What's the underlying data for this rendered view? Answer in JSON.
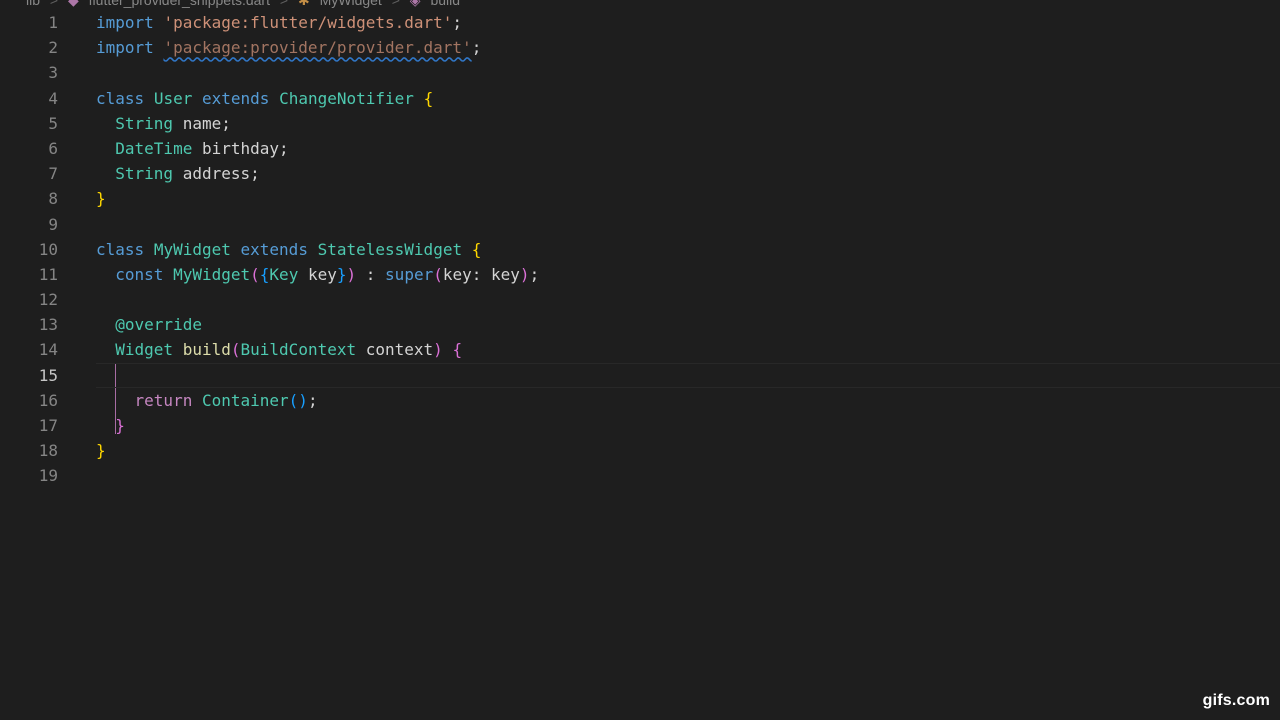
{
  "breadcrumb": {
    "folder": "lib",
    "file": "flutter_provider_snippets.dart",
    "class": "MyWidget",
    "method": "build",
    "separator": ">"
  },
  "lines": [
    {
      "n": "1",
      "tokens": [
        [
          "kw",
          "import"
        ],
        [
          "plain",
          " "
        ],
        [
          "str",
          "'package:flutter/widgets.dart'"
        ],
        [
          "plain",
          ";"
        ]
      ]
    },
    {
      "n": "2",
      "tokens": [
        [
          "kw",
          "import"
        ],
        [
          "plain",
          " "
        ],
        [
          "str squiggle",
          "'package:provider/provider.dart'"
        ],
        [
          "plain",
          ";"
        ]
      ]
    },
    {
      "n": "3",
      "tokens": []
    },
    {
      "n": "4",
      "tokens": [
        [
          "kw",
          "class"
        ],
        [
          "plain",
          " "
        ],
        [
          "type",
          "User"
        ],
        [
          "plain",
          " "
        ],
        [
          "kw",
          "extends"
        ],
        [
          "plain",
          " "
        ],
        [
          "type",
          "ChangeNotifier"
        ],
        [
          "plain",
          " "
        ],
        [
          "br1",
          "{"
        ]
      ]
    },
    {
      "n": "5",
      "tokens": [
        [
          "plain",
          "  "
        ],
        [
          "type",
          "String"
        ],
        [
          "plain",
          " name;"
        ]
      ]
    },
    {
      "n": "6",
      "tokens": [
        [
          "plain",
          "  "
        ],
        [
          "type",
          "DateTime"
        ],
        [
          "plain",
          " birthday;"
        ]
      ]
    },
    {
      "n": "7",
      "tokens": [
        [
          "plain",
          "  "
        ],
        [
          "type",
          "String"
        ],
        [
          "plain",
          " address;"
        ]
      ]
    },
    {
      "n": "8",
      "tokens": [
        [
          "br1",
          "}"
        ]
      ]
    },
    {
      "n": "9",
      "tokens": []
    },
    {
      "n": "10",
      "tokens": [
        [
          "kw",
          "class"
        ],
        [
          "plain",
          " "
        ],
        [
          "type",
          "MyWidget"
        ],
        [
          "plain",
          " "
        ],
        [
          "kw",
          "extends"
        ],
        [
          "plain",
          " "
        ],
        [
          "type",
          "StatelessWidget"
        ],
        [
          "plain",
          " "
        ],
        [
          "br1",
          "{"
        ]
      ]
    },
    {
      "n": "11",
      "tokens": [
        [
          "plain",
          "  "
        ],
        [
          "kw",
          "const"
        ],
        [
          "plain",
          " "
        ],
        [
          "type",
          "MyWidget"
        ],
        [
          "br2",
          "("
        ],
        [
          "br3",
          "{"
        ],
        [
          "type",
          "Key"
        ],
        [
          "plain",
          " key"
        ],
        [
          "br3",
          "}"
        ],
        [
          "br2",
          ")"
        ],
        [
          "plain",
          " : "
        ],
        [
          "kw",
          "super"
        ],
        [
          "br2",
          "("
        ],
        [
          "plain",
          "key: key"
        ],
        [
          "br2",
          ")"
        ],
        [
          "plain",
          ";"
        ]
      ]
    },
    {
      "n": "12",
      "tokens": []
    },
    {
      "n": "13",
      "tokens": [
        [
          "plain",
          "  "
        ],
        [
          "anno",
          "@override"
        ]
      ]
    },
    {
      "n": "14",
      "tokens": [
        [
          "plain",
          "  "
        ],
        [
          "type",
          "Widget"
        ],
        [
          "plain",
          " "
        ],
        [
          "fn",
          "build"
        ],
        [
          "br2",
          "("
        ],
        [
          "type",
          "BuildContext"
        ],
        [
          "plain",
          " context"
        ],
        [
          "br2",
          ")"
        ],
        [
          "plain",
          " "
        ],
        [
          "br2",
          "{"
        ]
      ]
    },
    {
      "n": "15",
      "tokens": []
    },
    {
      "n": "16",
      "tokens": [
        [
          "plain",
          "    "
        ],
        [
          "ctrl",
          "return"
        ],
        [
          "plain",
          " "
        ],
        [
          "type",
          "Container"
        ],
        [
          "br3",
          "()"
        ],
        [
          "plain",
          ";"
        ]
      ]
    },
    {
      "n": "17",
      "tokens": [
        [
          "plain",
          "  "
        ],
        [
          "br2",
          "}"
        ]
      ]
    },
    {
      "n": "18",
      "tokens": [
        [
          "br1",
          "}"
        ]
      ]
    },
    {
      "n": "19",
      "tokens": []
    }
  ],
  "active_line": "15",
  "watermark": "gifs.com"
}
